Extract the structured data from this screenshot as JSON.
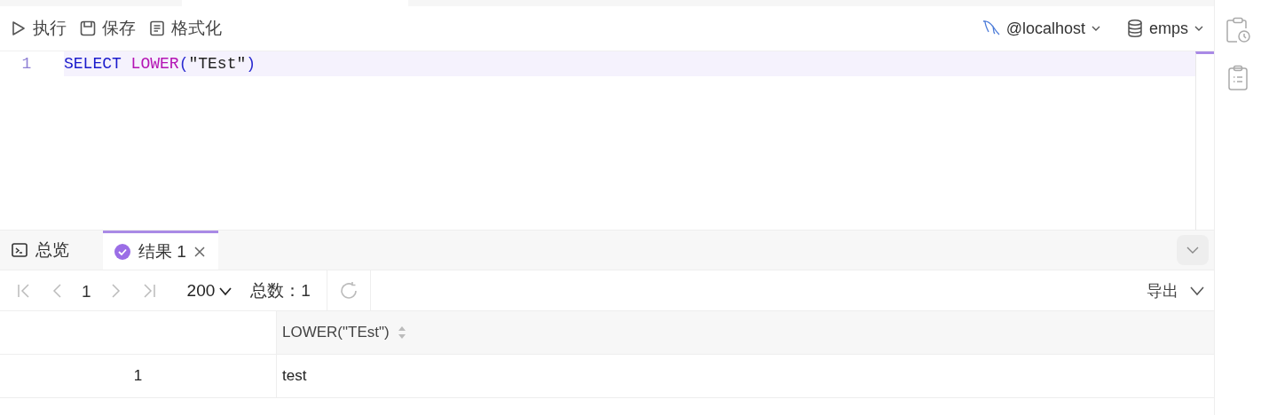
{
  "toolbar": {
    "actions": [
      {
        "kind": "run",
        "label": "执行"
      },
      {
        "kind": "save",
        "label": "保存"
      },
      {
        "kind": "format",
        "label": "格式化"
      }
    ],
    "connection": "@localhost",
    "database": "emps"
  },
  "editor": {
    "lines": [
      {
        "number": "1",
        "active": true,
        "tokens": [
          {
            "kind": "keyword",
            "text": "SELECT"
          },
          {
            "kind": "function",
            "text": "LOWER"
          },
          {
            "kind": "punct",
            "text": "("
          },
          {
            "kind": "string",
            "text": "\"TEst\""
          },
          {
            "kind": "punct",
            "text": ")"
          }
        ]
      }
    ]
  },
  "result_tabs": [
    {
      "kind": "console",
      "label": "总览",
      "selected": false
    },
    {
      "kind": "result",
      "label": "结果 1",
      "selected": true
    }
  ],
  "pager": {
    "page": "1",
    "page_size": "200",
    "total": "总数：1",
    "export": "导出"
  },
  "table": {
    "columns": [
      {
        "label": "LOWER(\"TEst\")"
      }
    ],
    "rows": [
      {
        "index": "1",
        "cells": [
          "test"
        ]
      }
    ]
  }
}
